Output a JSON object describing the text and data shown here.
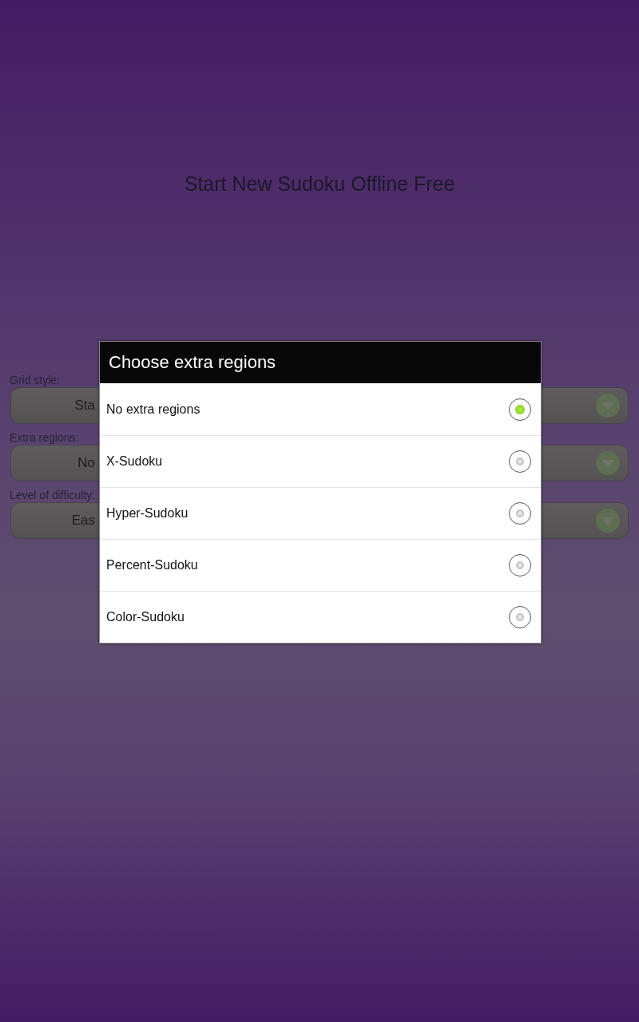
{
  "screen": {
    "title": "Start New Sudoku Offline Free"
  },
  "form": {
    "fields": [
      {
        "label": "Grid style:",
        "value": "Sta"
      },
      {
        "label": "Extra regions:",
        "value": "No"
      },
      {
        "label": "Level of difficulty:",
        "value": "Eas"
      }
    ]
  },
  "dialog": {
    "title": "Choose extra regions",
    "options": [
      {
        "label": "No extra regions",
        "selected": true
      },
      {
        "label": "X-Sudoku",
        "selected": false
      },
      {
        "label": "Hyper-Sudoku",
        "selected": false
      },
      {
        "label": "Percent-Sudoku",
        "selected": false
      },
      {
        "label": "Color-Sudoku",
        "selected": false
      }
    ]
  }
}
